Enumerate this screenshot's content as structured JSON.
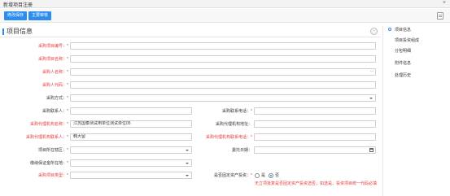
{
  "window": {
    "title": "新增项目注册",
    "close_glyph": "×"
  },
  "toolbar": {
    "save_label": "修改保存",
    "submit_label": "主要审核"
  },
  "section": {
    "title": "项目信息",
    "collapse_glyph": "-"
  },
  "form": {
    "project_code": {
      "label": "采购项目编号：",
      "value": ""
    },
    "project_name": {
      "label": "采购项目名称：",
      "value": ""
    },
    "purchaser_name": {
      "label": "采购人名称：",
      "value": "",
      "ellipsis": "..."
    },
    "purchaser_code": {
      "label": "采购人代码：",
      "value": ""
    },
    "purchase_method": {
      "label": "采购方式：",
      "value": ""
    },
    "contact_person": {
      "label": "采购联系人：",
      "value": ""
    },
    "contact_phone": {
      "label": "采购联系电话：",
      "value": ""
    },
    "agency_name": {
      "label": "采购代理机构名称：",
      "value": "江苏国泰测试用单位测试单位05"
    },
    "agency_address": {
      "label": "采购代理机构地址：",
      "value": ""
    },
    "agency_contact": {
      "label": "采购代理机构联系人：",
      "value": "韩大留"
    },
    "agency_phone": {
      "label": "采购代理机构联系电话：",
      "value": ""
    },
    "project_region": {
      "label": "项目所在辖区：",
      "value": ""
    },
    "commission_date": {
      "label": "委托日期：",
      "value": ""
    },
    "deposit_province": {
      "label": "缴纳保证金所在地：",
      "value": ""
    },
    "project_type": {
      "label": "采购项目类型：",
      "value": ""
    },
    "fixed_asset_invest": {
      "label": "是否固定资产投资：",
      "options": [
        "是",
        "否"
      ],
      "selected": "否",
      "hint": "无立项批复是否固定资产投资选否，如选是，投资项目统一代码必填"
    }
  },
  "sidenav": {
    "items": [
      "项目信息",
      "项目投资组成",
      "分包明细",
      "附件信息",
      "处理历史"
    ],
    "active": "项目信息"
  },
  "colors": {
    "accent": "#2d8cf0",
    "required": "#e23a3a"
  }
}
